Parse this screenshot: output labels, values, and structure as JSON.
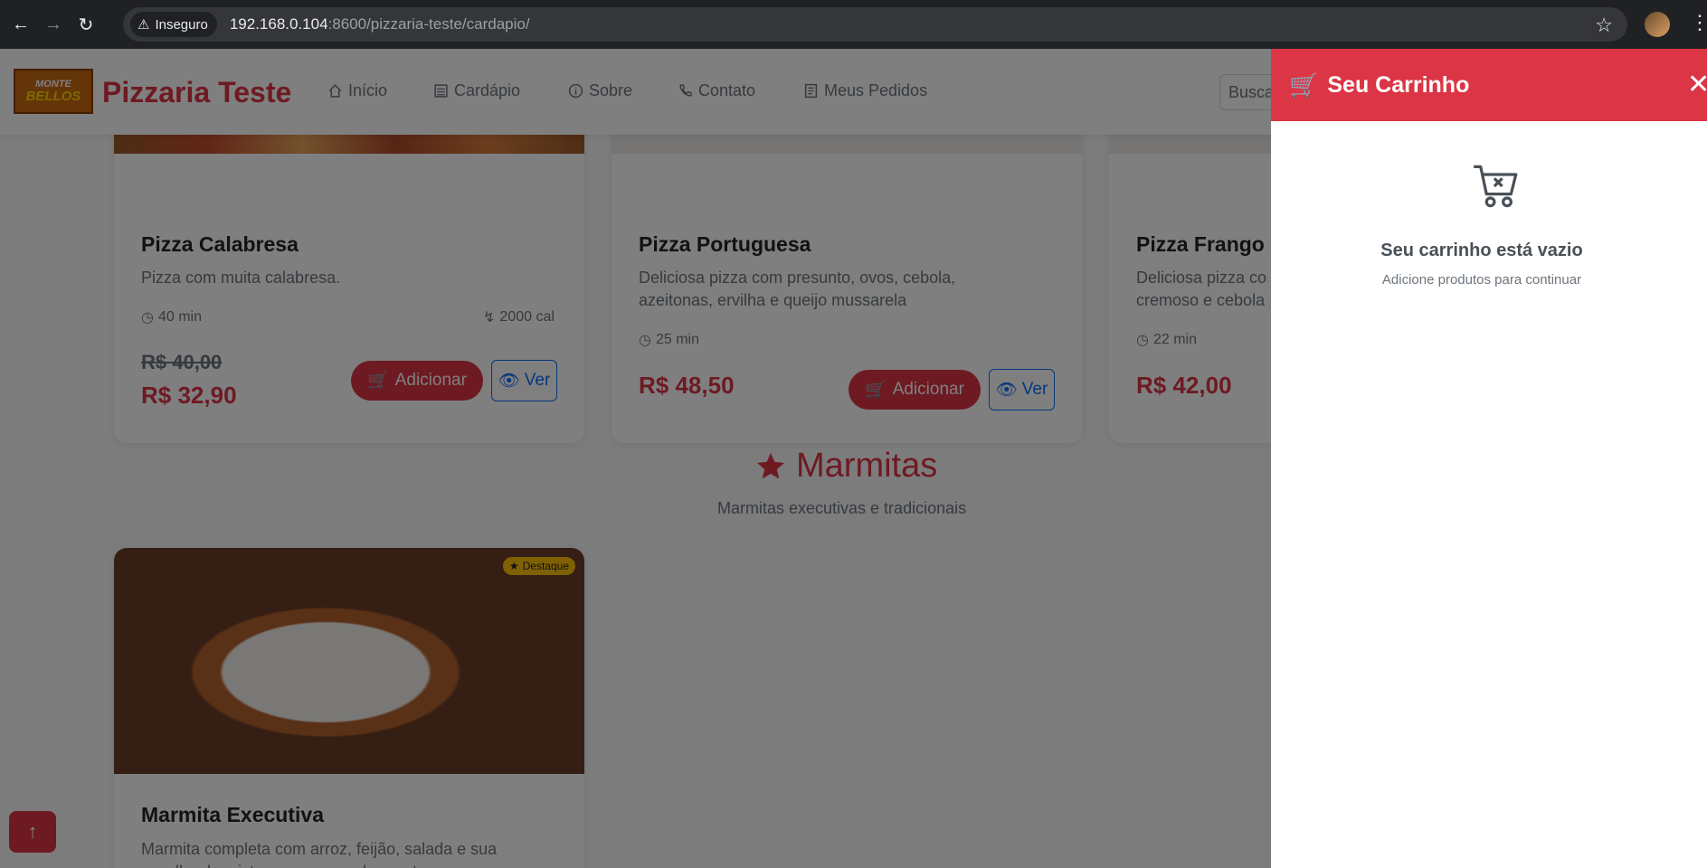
{
  "browser": {
    "security_label": "Inseguro",
    "url_host": "192.168.0.104",
    "url_rest": ":8600/pizzaria-teste/cardapio/"
  },
  "navbar": {
    "logo_line1": "MONTE",
    "logo_line2": "BELLOS",
    "brand": "Pizzaria Teste",
    "links": [
      {
        "label": "Início",
        "icon": "home-icon"
      },
      {
        "label": "Cardápio",
        "icon": "menu-book-icon"
      },
      {
        "label": "Sobre",
        "icon": "info-icon"
      },
      {
        "label": "Contato",
        "icon": "phone-icon"
      },
      {
        "label": "Meus Pedidos",
        "icon": "receipt-icon"
      }
    ],
    "search_placeholder": "Busca"
  },
  "products": [
    {
      "title": "Pizza Calabresa",
      "desc1": "Pizza com muita calabresa.",
      "desc2": "",
      "time": "40 min",
      "calories": "2000 cal",
      "old_price": "R$ 40,00",
      "price": "R$ 32,90",
      "add_label": "Adicionar",
      "view_label": "Ver"
    },
    {
      "title": "Pizza Portuguesa",
      "desc1": "Deliciosa pizza com presunto, ovos, cebola,",
      "desc2": "azeitonas, ervilha e queijo mussarela",
      "time": "25 min",
      "price": "R$ 48,50",
      "add_label": "Adicionar",
      "view_label": "Ver"
    },
    {
      "title": "Pizza Frango C",
      "desc1": "Deliciosa pizza co",
      "desc2": "cremoso e cebola",
      "time": "22 min",
      "price": "R$ 42,00"
    }
  ],
  "section": {
    "title": "Marmitas",
    "subtitle": "Marmitas executivas e tradicionais"
  },
  "marmita": {
    "badge": "Destaque",
    "title": "Marmita Executiva",
    "desc1": "Marmita completa com arroz, feijão, salada e sua",
    "desc2": "escolha de mistura e acompanhamentos"
  },
  "cart": {
    "title": "Seu Carrinho",
    "empty_title": "Seu carrinho está vazio",
    "empty_subtitle": "Adicione produtos para continuar"
  },
  "colors": {
    "accent": "#dc3545",
    "secondary": "#0d6efd",
    "badge": "#ffc107"
  }
}
